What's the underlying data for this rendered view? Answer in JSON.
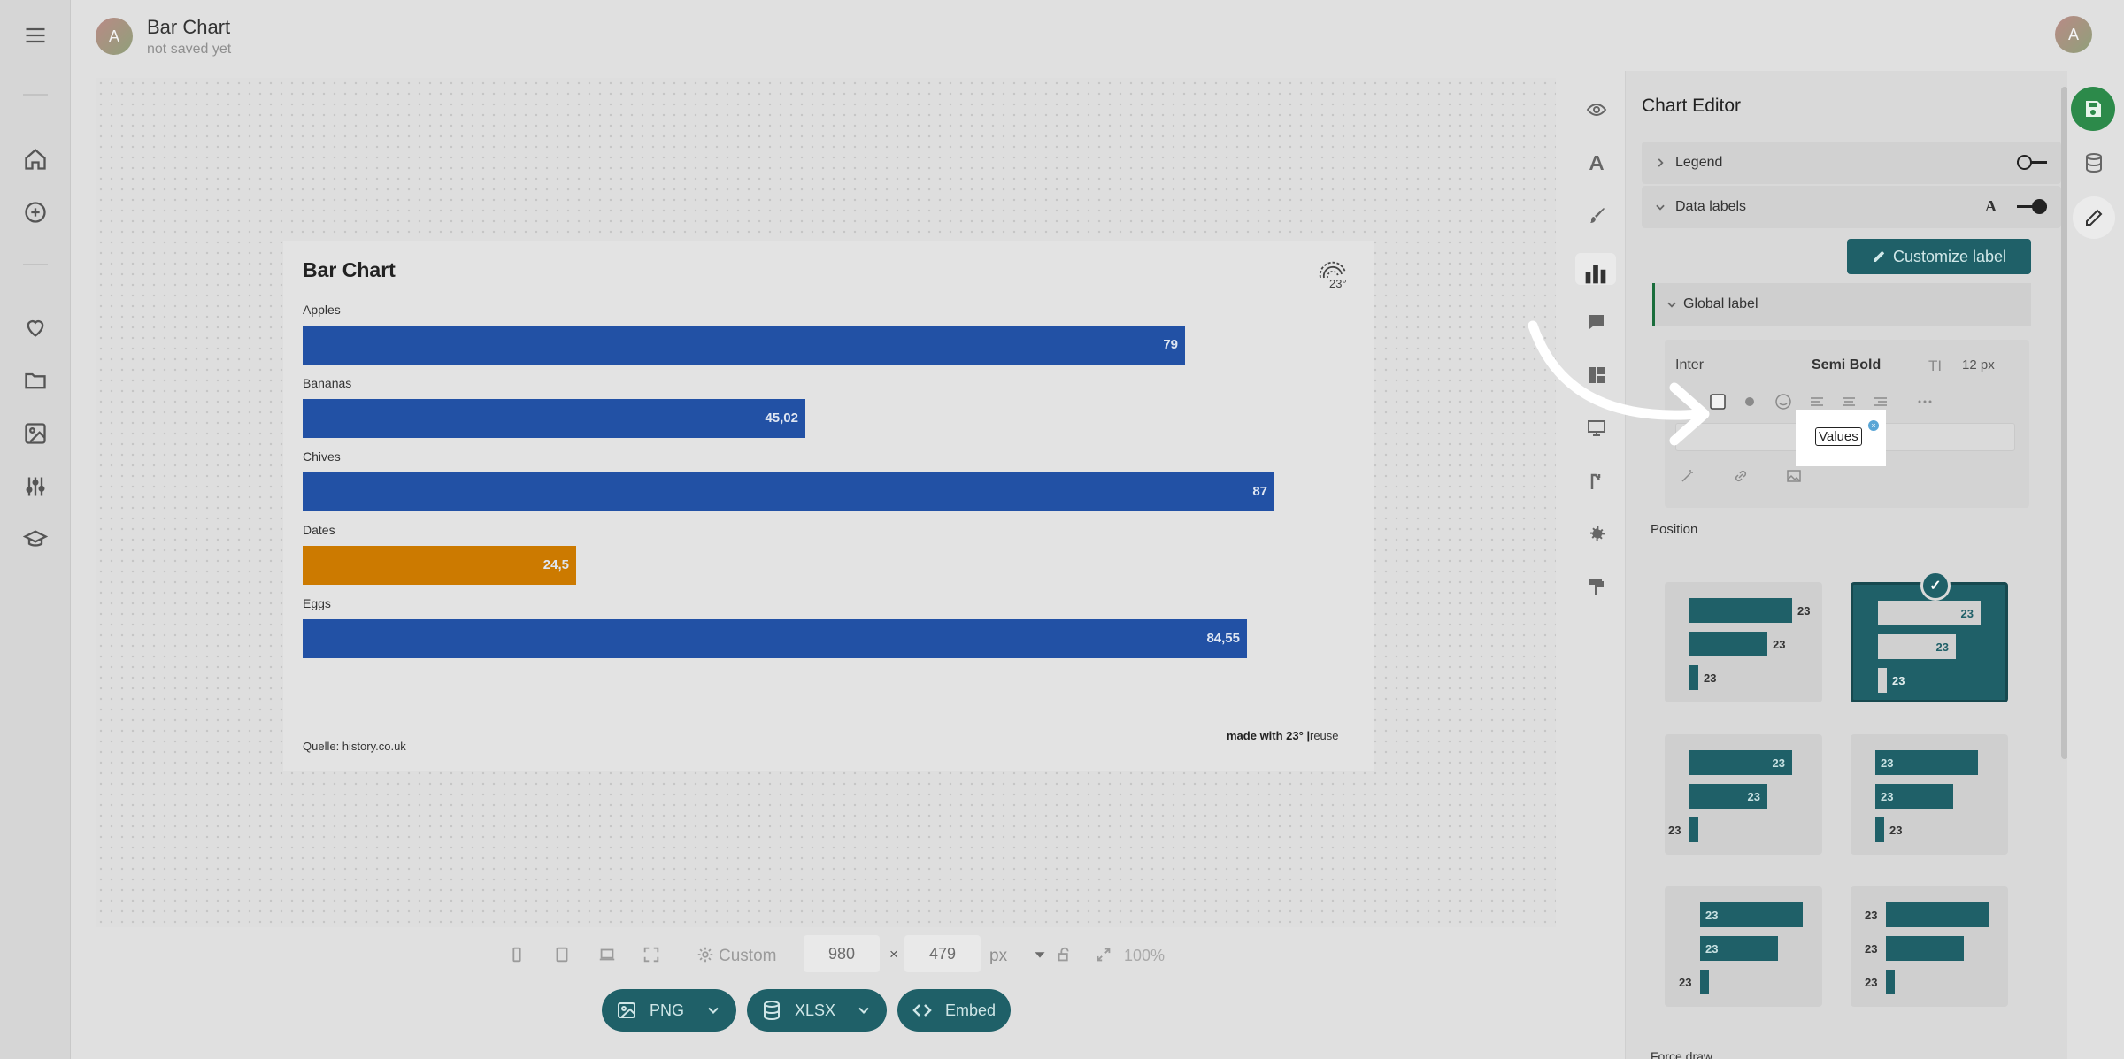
{
  "header": {
    "avatar_letter": "A",
    "title": "Bar Chart",
    "subtitle": "not saved yet",
    "user_avatar_letter": "A"
  },
  "sidebar": {
    "items": [
      {
        "icon": "menu-icon"
      },
      {
        "icon": "home-icon"
      },
      {
        "icon": "plus-circle-icon"
      },
      {
        "icon": "heart-icon"
      },
      {
        "icon": "folder-icon"
      },
      {
        "icon": "image-icon"
      },
      {
        "icon": "sliders-icon"
      },
      {
        "icon": "graduation-cap-icon"
      }
    ]
  },
  "chart": {
    "title": "Bar Chart",
    "source": "Quelle: history.co.uk",
    "made_with": "made with 23° |",
    "reuse": "reuse",
    "logo_text": "23°"
  },
  "chart_data": {
    "type": "bar",
    "orientation": "horizontal",
    "title": "Bar Chart",
    "categories": [
      "Apples",
      "Bananas",
      "Chives",
      "Dates",
      "Eggs"
    ],
    "values": [
      79,
      45.02,
      87,
      24.5,
      84.55
    ],
    "value_labels": [
      "79",
      "45,02",
      "87",
      "24,5",
      "84,55"
    ],
    "colors": [
      "#2251a5",
      "#2251a5",
      "#2251a5",
      "#cc7a00",
      "#2251a5"
    ],
    "xlim": [
      0,
      87
    ],
    "grid": false,
    "legend": "none"
  },
  "toolbar": {
    "preset": "Custom",
    "width": "980",
    "height": "479",
    "times": "×",
    "unit": "px",
    "zoom": "100%",
    "exports": [
      {
        "label": "PNG"
      },
      {
        "label": "XLSX"
      },
      {
        "label": "Embed"
      }
    ]
  },
  "editor": {
    "title": "Chart Editor",
    "legend_label": "Legend",
    "legend_on": false,
    "data_labels_label": "Data labels",
    "data_labels_on": true,
    "customize_label": "Customize label",
    "global_label": "Global label",
    "font_name": "Inter",
    "font_weight": "Semi Bold",
    "font_size_icon": "TI",
    "font_size": "12 px",
    "values_chip": "Values",
    "values_badge": "×",
    "position_title": "Position",
    "position_sample_value": "23",
    "force_draw": "Force draw"
  },
  "colors": {
    "accent": "#1f6068",
    "bar": "#2251a5",
    "highlight": "#cc7a00",
    "save": "#2c8a4a"
  }
}
